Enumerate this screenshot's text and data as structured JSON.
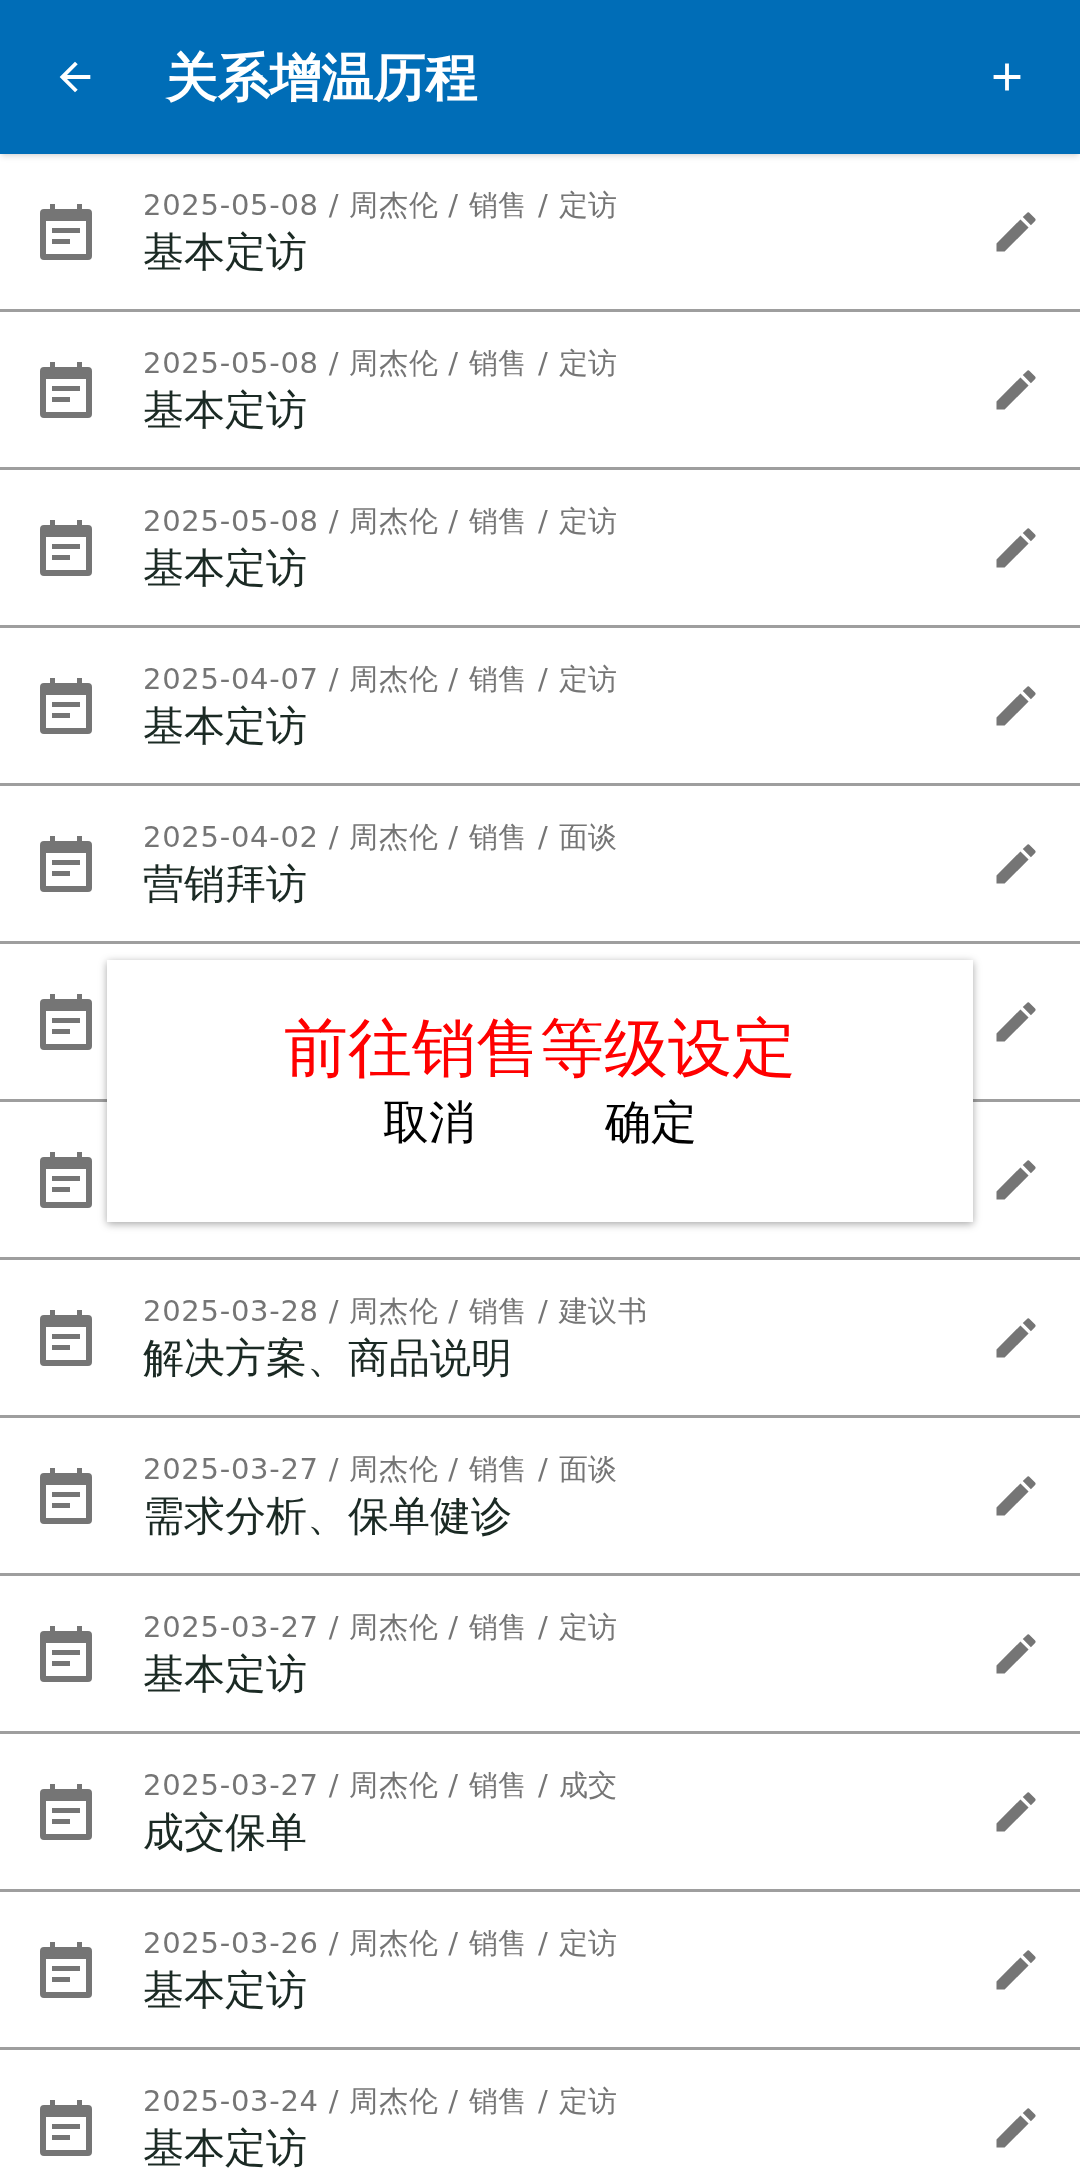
{
  "app_bar": {
    "title": "关系增温历程"
  },
  "rows": [
    {
      "kind": "entry",
      "meta": "2025-05-08 / 周杰伦 / 销售 / 定访",
      "title": "基本定访"
    },
    {
      "kind": "entry",
      "meta": "2025-05-08 / 周杰伦 / 销售 / 定访",
      "title": "基本定访"
    },
    {
      "kind": "entry",
      "meta": "2025-05-08 / 周杰伦 / 销售 / 定访",
      "title": "基本定访"
    },
    {
      "kind": "entry",
      "meta": "2025-04-07 / 周杰伦 / 销售 / 定访",
      "title": "基本定访"
    },
    {
      "kind": "entry",
      "meta": "2025-04-02 / 周杰伦 / 销售 / 面谈",
      "title": "营销拜访"
    },
    {
      "kind": "covered"
    },
    {
      "kind": "covered"
    },
    {
      "kind": "entry",
      "meta": "2025-03-28 / 周杰伦 / 销售 / 建议书",
      "title": "解决方案、商品说明"
    },
    {
      "kind": "entry",
      "meta": "2025-03-27 / 周杰伦 / 销售 / 面谈",
      "title": "需求分析、保单健诊"
    },
    {
      "kind": "entry",
      "meta": "2025-03-27 / 周杰伦 / 销售 / 定访",
      "title": "基本定访"
    },
    {
      "kind": "entry",
      "meta": "2025-03-27 / 周杰伦 / 销售 / 成交",
      "title": "成交保单"
    },
    {
      "kind": "entry",
      "meta": "2025-03-26 / 周杰伦 / 销售 / 定访",
      "title": "基本定访"
    },
    {
      "kind": "entry",
      "meta": "2025-03-24 / 周杰伦 / 销售 / 定访",
      "title": "基本定访"
    }
  ],
  "dialog": {
    "message": "前往销售等级设定",
    "buttons": [
      "取消",
      "确定"
    ]
  }
}
